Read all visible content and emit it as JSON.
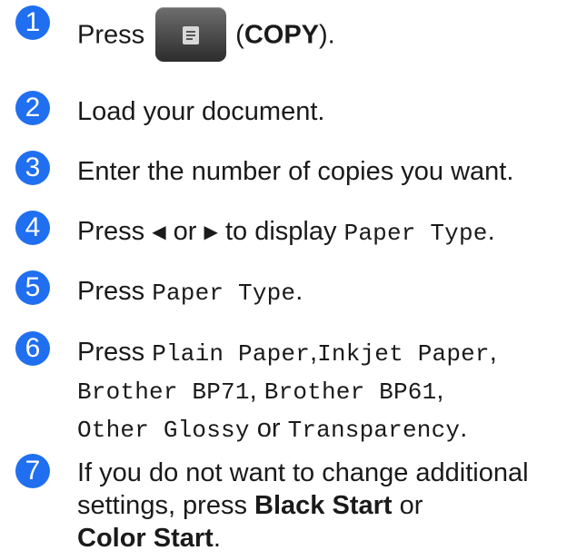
{
  "steps": [
    {
      "number": "1",
      "press": "Press",
      "open_paren": "(",
      "copy_label": "COPY",
      "close_paren": ")."
    },
    {
      "number": "2",
      "text": "Load your document."
    },
    {
      "number": "3",
      "text": "Enter the number of copies you want."
    },
    {
      "number": "4",
      "press": "Press",
      "left_arrow": "◀",
      "or": "or",
      "right_arrow": "▶",
      "to_display": "to display",
      "option": "Paper Type",
      "period": "."
    },
    {
      "number": "5",
      "press": "Press",
      "option": "Paper Type",
      "period": "."
    },
    {
      "number": "6",
      "press": "Press",
      "options": [
        "Plain Paper",
        "Inkjet Paper",
        "Brother BP71",
        "Brother BP61",
        "Other Glossy",
        "Transparency"
      ],
      "or": "or",
      "comma": ",",
      "period": "."
    },
    {
      "number": "7",
      "line1": "If you do not want to change additional",
      "line2_prefix": "settings, press",
      "black_start": "Black Start",
      "or": "or",
      "color_start": "Color Start",
      "period": "."
    }
  ],
  "colors": {
    "step_badge": "#1f6ff0",
    "text": "#1a1a1a"
  },
  "icons": {
    "copy_button": "copy-document-icon"
  }
}
